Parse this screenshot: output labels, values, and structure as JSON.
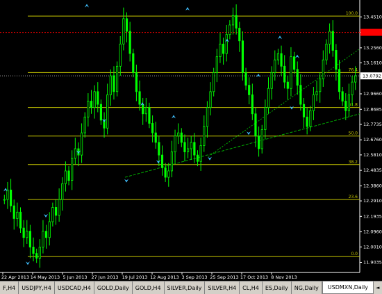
{
  "chart_data": {
    "type": "candlestick",
    "symbol": "USDMXN",
    "timeframe": "Daily",
    "ylim": [
      11.84,
      13.54
    ],
    "price_ticks": [
      "13.4510",
      "13.3535",
      "13.2560",
      "13.1610",
      "13.0792",
      "12.9660",
      "12.8685",
      "12.7735",
      "12.6760",
      "12.5810",
      "12.4835",
      "12.3860",
      "12.2910",
      "12.1935",
      "12.0960",
      "12.0010",
      "11.9035"
    ],
    "current_price_label": "13.0792",
    "current_price": 13.0792,
    "red_level": 13.3535,
    "date_ticks": [
      "22 Apr 2013",
      "14 May 2013",
      "5 Jun 2013",
      "27 Jun 2013",
      "19 Jul 2013",
      "12 Aug 2013",
      "3 Sep 2013",
      "25 Sep 2013",
      "17 Oct 2013",
      "8 Nov 2013"
    ],
    "fib_levels": [
      {
        "label": "100.0",
        "value": 13.456
      },
      {
        "label": "76.4",
        "value": 13.1
      },
      {
        "label": "61.8",
        "value": 12.88
      },
      {
        "label": "50.0",
        "value": 12.7
      },
      {
        "label": "38.2",
        "value": 12.52
      },
      {
        "label": "23.6",
        "value": 12.3
      },
      {
        "label": "0.0",
        "value": 11.94
      }
    ],
    "closes": [
      12.3,
      12.36,
      12.26,
      12.18,
      12.22,
      12.12,
      12.06,
      12.1,
      12.0,
      11.96,
      11.93,
      12.0,
      12.1,
      12.06,
      12.16,
      12.25,
      12.2,
      12.3,
      12.4,
      12.48,
      12.42,
      12.56,
      12.62,
      12.58,
      12.72,
      12.82,
      12.92,
      12.88,
      12.98,
      12.9,
      12.8,
      12.75,
      12.96,
      13.08,
      12.98,
      13.14,
      13.28,
      13.44,
      13.36,
      13.22,
      13.1,
      12.98,
      12.9,
      12.84,
      12.88,
      12.78,
      12.72,
      12.66,
      12.58,
      12.5,
      12.44,
      12.48,
      12.6,
      12.7,
      12.72,
      12.66,
      12.6,
      12.62,
      12.66,
      12.58,
      12.54,
      12.64,
      12.76,
      12.88,
      12.98,
      13.1,
      13.2,
      13.28,
      13.22,
      13.34,
      13.4,
      13.46,
      13.38,
      13.3,
      13.1,
      13.02,
      12.96,
      12.84,
      12.7,
      12.62,
      12.74,
      12.88,
      13.0,
      13.1,
      13.18,
      13.22,
      13.14,
      13.04,
      13.0,
      13.2,
      13.12,
      13.02,
      12.9,
      12.82,
      12.76,
      12.86,
      12.96,
      12.98,
      13.06,
      13.18,
      13.28,
      13.36,
      13.24,
      13.12,
      12.98,
      12.92,
      12.86,
      12.96,
      13.04,
      13.08
    ]
  },
  "tabs": [
    "F,H4",
    "USDJPY,H4",
    "USDCAD,H4",
    "GOLD,Daily",
    "GOLD,H4",
    "SILVER,Daily",
    "SILVER,H4",
    "CL,H4",
    "ES,Daily",
    "NG,Daily",
    "USDMXN,Daily"
  ],
  "active_tab": "USDMXN,Daily",
  "colors": {
    "candle": "#00ff00",
    "fib": "#c8c800",
    "red_level": "#ff0000",
    "trendline": "#00b000",
    "fractal": "#40c0ff",
    "grid_text": "#ffffff"
  },
  "icons": {
    "scroll_left": "◄",
    "scroll_right": "►"
  }
}
